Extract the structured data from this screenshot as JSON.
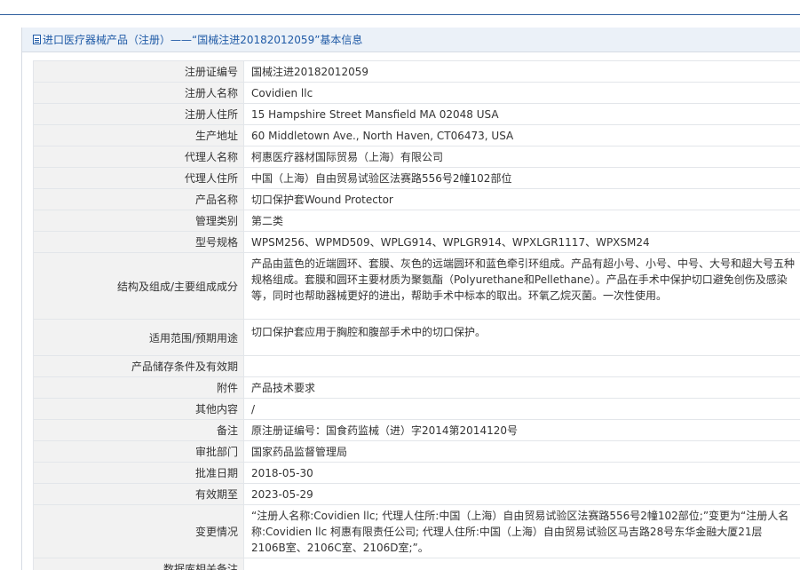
{
  "header": {
    "title": "进口医疗器械产品（注册）——“国械注进20182012059”基本信息"
  },
  "rows": [
    {
      "label": "注册证编号",
      "value": "国械注进20182012059"
    },
    {
      "label": "注册人名称",
      "value": "Covidien llc"
    },
    {
      "label": "注册人住所",
      "value": "15 Hampshire Street Mansfield MA 02048 USA"
    },
    {
      "label": "生产地址",
      "value": "60 Middletown Ave., North Haven, CT06473, USA"
    },
    {
      "label": "代理人名称",
      "value": "柯惠医疗器材国际贸易（上海）有限公司"
    },
    {
      "label": "代理人住所",
      "value": "中国（上海）自由贸易试验区法赛路556号2幢102部位"
    },
    {
      "label": "产品名称",
      "value": "切口保护套Wound Protector"
    },
    {
      "label": "管理类别",
      "value": "第二类"
    },
    {
      "label": "型号规格",
      "value": "WPSM256、WPMD509、WPLG914、WPLGR914、WPXLGR1117、WPXSM24"
    },
    {
      "label": "结构及组成/主要组成成分",
      "value": "产品由蓝色的近端圆环、套膜、灰色的远端圆环和蓝色牵引环组成。产品有超小号、小号、中号、大号和超大号五种规格组成。套膜和圆环主要材质为聚氨酯（Polyurethane和Pellethane）。产品在手术中保护切口避免创伤及感染等，同时也帮助器械更好的进出，帮助手术中标本的取出。环氧乙烷灭菌。一次性使用。"
    },
    {
      "label": "适用范围/预期用途",
      "value": "切口保护套应用于胸腔和腹部手术中的切口保护。"
    },
    {
      "label": "产品储存条件及有效期",
      "value": ""
    },
    {
      "label": "附件",
      "value": "产品技术要求"
    },
    {
      "label": "其他内容",
      "value": "/"
    },
    {
      "label": "备注",
      "value": "原注册证编号：国食药监械（进）字2014第2014120号"
    },
    {
      "label": "审批部门",
      "value": "国家药品监督管理局"
    },
    {
      "label": "批准日期",
      "value": "2018-05-30"
    },
    {
      "label": "有效期至",
      "value": "2023-05-29"
    },
    {
      "label": "变更情况",
      "value": "“注册人名称:Covidien llc; 代理人住所:中国（上海）自由贸易试验区法赛路556号2幢102部位;”变更为“注册人名称:Covidien llc 柯惠有限责任公司; 代理人住所:中国（上海）自由贸易试验区马吉路28号东华金融大厦21层2106B室、2106C室、2106D室;”。"
    },
    {
      "label": "数据库相关备注",
      "value": ""
    }
  ]
}
